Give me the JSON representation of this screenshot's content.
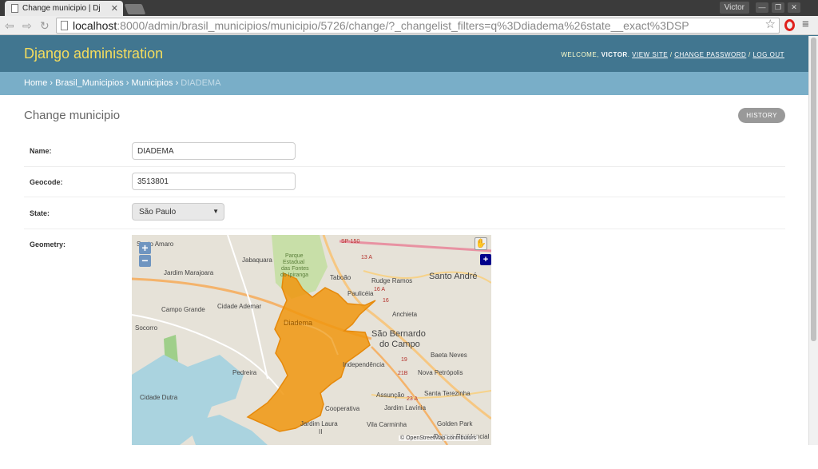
{
  "browser": {
    "tab_title": "Change municipio | Dj",
    "user": "Victor",
    "url_host": "localhost",
    "url_rest": ":8000/admin/brasil_municipios/municipio/5726/change/?_changelist_filters=q%3Ddiadema%26state__exact%3DSP"
  },
  "header": {
    "brand": "Django administration",
    "welcome": "WELCOME,",
    "username": "VICTOR",
    "view_site": "VIEW SITE",
    "change_password": "CHANGE PASSWORD",
    "log_out": "LOG OUT",
    "sep": " / "
  },
  "breadcrumbs": {
    "home": "Home",
    "app": "Brasil_Municipios",
    "model": "Municipios",
    "current": "DIADEMA",
    "sep": "›"
  },
  "page": {
    "title": "Change municipio",
    "history_button": "HISTORY"
  },
  "form": {
    "name_label": "Name:",
    "name_value": "DIADEMA",
    "geocode_label": "Geocode:",
    "geocode_value": "3513801",
    "state_label": "State:",
    "state_value": "São Paulo",
    "geometry_label": "Geometry:"
  },
  "map": {
    "labels": {
      "santo_amaro": "Santo Amaro",
      "jabaquara": "Jabaquara",
      "jardim_marajoara": "Jardim Marajoara",
      "taboao": "Taboão",
      "rudge_ramos": "Rudge Ramos",
      "santo_andre": "Santo André",
      "pauliceia": "Paulicéia",
      "campo_grande": "Campo Grande",
      "cidade_ademar": "Cidade Ademar",
      "anchieta": "Anchieta",
      "socorro": "Socorro",
      "diadema": "Diadema",
      "sao_bernardo_1": "São Bernardo",
      "sao_bernardo_2": "do Campo",
      "baeta_neves": "Baeta Neves",
      "pedreira": "Pedreira",
      "independencia": "Independência",
      "nova_petropolis": "Nova Petrópolis",
      "cidade_dutra": "Cidade Dutra",
      "assuncao": "Assunção",
      "santa_terezinha": "Santa Terezinha",
      "jardim_lavinia": "Jardim Lavínia",
      "cooperativa": "Cooperativa",
      "vila_carminha": "Vila Carminha",
      "golden_park": "Golden Park",
      "jardim_laura_1": "Jardim Laura",
      "jardim_laura_2": "II",
      "parque_residencial": "Parque Residencial",
      "parque_estadual_1": "Parque",
      "parque_estadual_2": "Estadual",
      "parque_estadual_3": "das Fontes",
      "parque_estadual_4": "do Ipiranga",
      "road_sp150": "SP-150",
      "road_13a": "13 A",
      "road_16a": "16 A",
      "road_16": "16",
      "road_19": "19",
      "road_21b": "21B",
      "road_23a": "23 A"
    },
    "attribution": "© OpenStreetMap contributors",
    "zoom_in": "+",
    "zoom_out": "−",
    "pan_icon": "✋",
    "layer_switch": "+",
    "polygon_color": "#f0960f"
  }
}
